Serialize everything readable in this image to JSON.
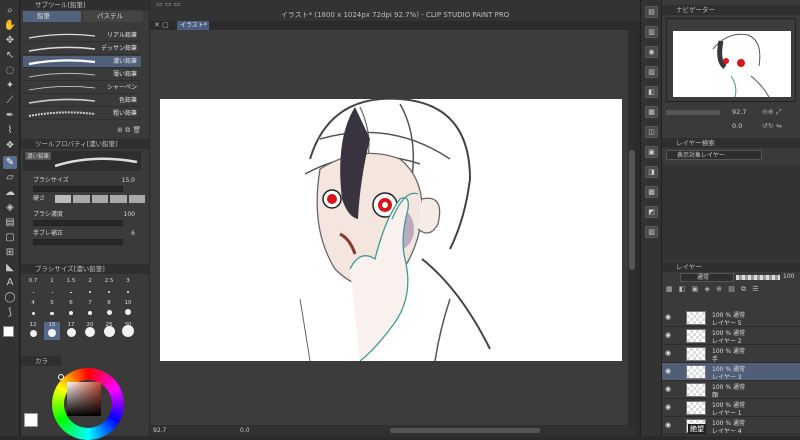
{
  "app": {
    "title": "イラスト* (1800 x 1024px 72dpi 92.7%) - CLIP STUDIO PAINT PRO",
    "doc_tab": "イラスト*"
  },
  "subtool": {
    "header": "サブツール[鉛筆]",
    "tabs": [
      "鉛筆",
      "パステル"
    ],
    "brushes": [
      "リアル鉛筆",
      "デッサン鉛筆",
      "濃い鉛筆",
      "薄い鉛筆",
      "シャーペン",
      "色鉛筆",
      "粗い鉛筆"
    ],
    "selected_brush": 2
  },
  "tool_property": {
    "header": "ツールプロパティ[濃い鉛筆]",
    "preset_name": "濃い鉛筆",
    "brush_size_label": "ブラシサイズ",
    "brush_size_value": "15.0",
    "hardness_label": "硬さ",
    "density_label": "ブラシ濃度",
    "density_value": "100",
    "stabilization_label": "手ブレ補正",
    "stabilization_value": "6"
  },
  "brush_size_panel": {
    "header": "ブラシサイズ[濃い鉛筆]",
    "sizes": [
      "0.7",
      "1",
      "1.5",
      "2",
      "2.5",
      "3",
      "4",
      "5",
      "6",
      "7",
      "8",
      "10",
      "12",
      "15",
      "17",
      "20",
      "25",
      "30"
    ],
    "selected": "15"
  },
  "color_panel": {
    "header": "カラ"
  },
  "navigator": {
    "header": "ナビゲーター",
    "zoom": "92.7",
    "rotate": "0.0"
  },
  "layer_search": {
    "header": "レイヤー検索",
    "filter": "表示対象レイヤー"
  },
  "layer_panel": {
    "header": "レイヤー",
    "blend": "通常",
    "opacity": "100",
    "layers": [
      {
        "line1": "100 % 通常",
        "line2": "レイヤー 5"
      },
      {
        "line1": "100 % 通常",
        "line2": "レイヤー 2"
      },
      {
        "line1": "100 % 通常",
        "line2": "手"
      },
      {
        "line1": "100 % 通常",
        "line2": "レイヤー 3"
      },
      {
        "line1": "100 % 通常",
        "line2": "顔"
      },
      {
        "line1": "100 % 通常",
        "line2": "レイヤー 1"
      },
      {
        "line1": "100 % 通常",
        "line2": "レイヤー 4"
      }
    ],
    "selected_layer": 3,
    "folder_label": "絶望"
  },
  "status": {
    "zoom": "92.7",
    "angle": "0.0"
  },
  "colors": {
    "accent": "#5a6f8f",
    "selected_row": "#50607a",
    "main_color": "#ffffff",
    "sub_color": "#3f3f3f"
  }
}
